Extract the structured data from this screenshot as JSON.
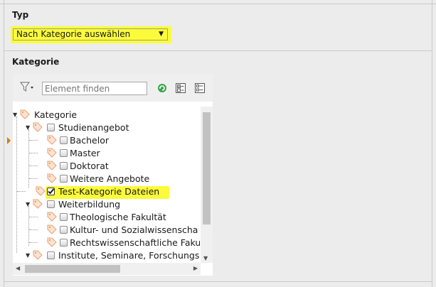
{
  "typ": {
    "label": "Typ",
    "selected": "Nach Kategorie auswählen"
  },
  "kategorie": {
    "label": "Kategorie",
    "search_placeholder": "Element finden",
    "tree": [
      {
        "label": "Kategorie",
        "checkbox": false,
        "checked": false,
        "expanded": true
      },
      {
        "label": "Studienangebot",
        "checkbox": true,
        "checked": false,
        "expanded": true
      },
      {
        "label": "Bachelor",
        "checkbox": true,
        "checked": false
      },
      {
        "label": "Master",
        "checkbox": true,
        "checked": false
      },
      {
        "label": "Doktorat",
        "checkbox": true,
        "checked": false
      },
      {
        "label": "Weitere Angebote",
        "checkbox": true,
        "checked": false
      },
      {
        "label": "Test-Kategorie Dateien",
        "checkbox": true,
        "checked": true
      },
      {
        "label": "Weiterbildung",
        "checkbox": true,
        "checked": false,
        "expanded": true
      },
      {
        "label": "Theologische Fakultät",
        "checkbox": true,
        "checked": false
      },
      {
        "label": "Kultur- und Sozialwissenscha",
        "checkbox": true,
        "checked": false
      },
      {
        "label": "Rechtswissenschaftliche Faku",
        "checkbox": true,
        "checked": false
      },
      {
        "label": "Institute, Seminare, Forschungs",
        "checkbox": true,
        "checked": false,
        "expanded": true
      }
    ]
  },
  "colors": {
    "highlight": "#fbfb3c",
    "background": "#ececec",
    "tag_icon": "#e8a070",
    "accent_marker": "#d97a00"
  },
  "icons": [
    "filter-icon",
    "refresh-icon",
    "expand-all-icon",
    "collapse-all-icon",
    "tag-icon",
    "chevron-down-icon"
  ]
}
